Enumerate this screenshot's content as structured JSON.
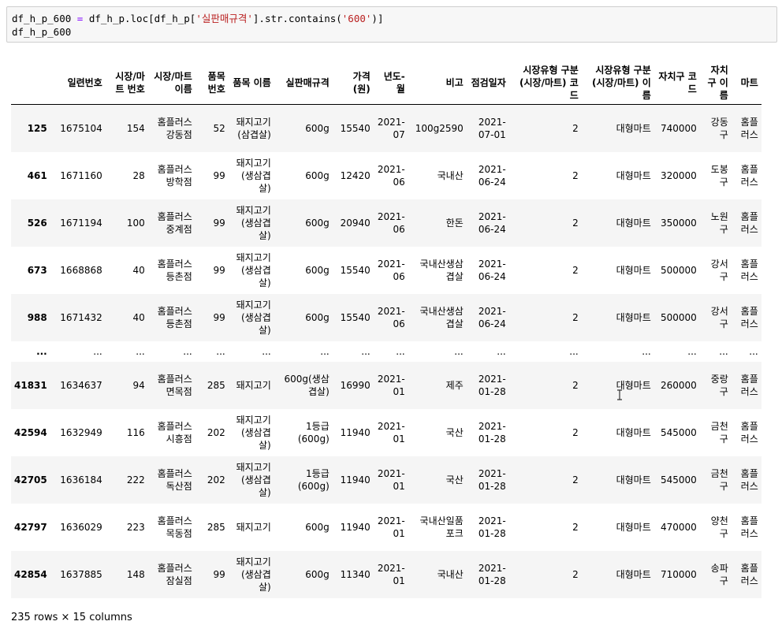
{
  "code": {
    "line1_pre": "df_h_p_600 ",
    "line1_eq": "=",
    "line1_mid": " df_h_p.loc[df_h_p[",
    "line1_str1": "'실판매규격'",
    "line1_mid2": "].str.contains(",
    "line1_str2": "'600'",
    "line1_end": ")]",
    "line2": "df_h_p_600"
  },
  "table": {
    "columns": [
      "",
      "일련번호",
      "시장/마트 번호",
      "시장/마트 이름",
      "품목 번호",
      "품목 이름",
      "실판매규격",
      "가격(원)",
      "년도-월",
      "비고",
      "점검일자",
      "시장유형 구분(시장/마트) 코드",
      "시장유형 구분(시장/마트) 이름",
      "자치구 코드",
      "자치구 이름",
      "마트"
    ],
    "rows": [
      [
        "125",
        "1675104",
        "154",
        "홈플러스 강동점",
        "52",
        "돼지고기(삼겹살)",
        "600g",
        "15540",
        "2021-07",
        "100g2590",
        "2021-07-01",
        "2",
        "대형마트",
        "740000",
        "강동구",
        "홈플러스"
      ],
      [
        "461",
        "1671160",
        "28",
        "홈플러스 방학점",
        "99",
        "돼지고기(생삼겹살)",
        "600g",
        "12420",
        "2021-06",
        "국내산",
        "2021-06-24",
        "2",
        "대형마트",
        "320000",
        "도봉구",
        "홈플러스"
      ],
      [
        "526",
        "1671194",
        "100",
        "홈플러스 중계점",
        "99",
        "돼지고기(생삼겹살)",
        "600g",
        "20940",
        "2021-06",
        "한돈",
        "2021-06-24",
        "2",
        "대형마트",
        "350000",
        "노원구",
        "홈플러스"
      ],
      [
        "673",
        "1668868",
        "40",
        "홈플러스 등촌점",
        "99",
        "돼지고기(생삼겹살)",
        "600g",
        "15540",
        "2021-06",
        "국내산생삼겹살",
        "2021-06-24",
        "2",
        "대형마트",
        "500000",
        "강서구",
        "홈플러스"
      ],
      [
        "988",
        "1671432",
        "40",
        "홈플러스 등촌점",
        "99",
        "돼지고기(생삼겹살)",
        "600g",
        "15540",
        "2021-06",
        "국내산생삼겹살",
        "2021-06-24",
        "2",
        "대형마트",
        "500000",
        "강서구",
        "홈플러스"
      ],
      [
        "...",
        "...",
        "...",
        "...",
        "...",
        "...",
        "...",
        "...",
        "...",
        "...",
        "...",
        "...",
        "...",
        "...",
        "...",
        "..."
      ],
      [
        "41831",
        "1634637",
        "94",
        "홈플러스 면목점",
        "285",
        "돼지고기",
        "600g(생삼겹살)",
        "16990",
        "2021-01",
        "제주",
        "2021-01-28",
        "2",
        "대형마트",
        "260000",
        "중랑구",
        "홈플러스"
      ],
      [
        "42594",
        "1632949",
        "116",
        "홈플러스 시흥점",
        "202",
        "돼지고기(생삼겹살)",
        "1등급(600g)",
        "11940",
        "2021-01",
        "국산",
        "2021-01-28",
        "2",
        "대형마트",
        "545000",
        "금천구",
        "홈플러스"
      ],
      [
        "42705",
        "1636184",
        "222",
        "홈플러스 독산점",
        "202",
        "돼지고기(생삼겹살)",
        "1등급(600g)",
        "11940",
        "2021-01",
        "국산",
        "2021-01-28",
        "2",
        "대형마트",
        "545000",
        "금천구",
        "홈플러스"
      ],
      [
        "42797",
        "1636029",
        "223",
        "홈플러스 목동점",
        "285",
        "돼지고기",
        "600g",
        "11940",
        "2021-01",
        "국내산일품포크",
        "2021-01-28",
        "2",
        "대형마트",
        "470000",
        "양천구",
        "홈플러스"
      ],
      [
        "42854",
        "1637885",
        "148",
        "홈플러스 잠실점",
        "99",
        "돼지고기(생삼겹살)",
        "600g",
        "11340",
        "2021-01",
        "국내산",
        "2021-01-28",
        "2",
        "대형마트",
        "710000",
        "송파구",
        "홈플러스"
      ]
    ]
  },
  "shape_note": "235 rows × 15 columns",
  "icons": {
    "cursor": "text-cursor-icon"
  }
}
